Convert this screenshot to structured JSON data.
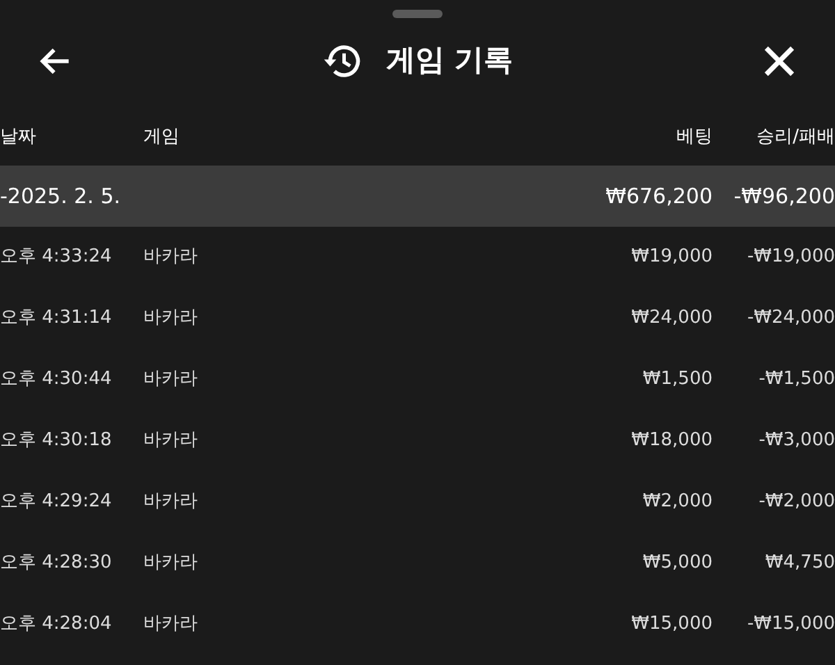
{
  "header": {
    "title": "게임 기록"
  },
  "columns": {
    "date": "날짜",
    "game": "게임",
    "bet": "베팅",
    "result": "승리/패배"
  },
  "groups": [
    {
      "date": "-2025. 2. 5.",
      "bet": "₩676,200",
      "result": "-₩96,200",
      "rows": [
        {
          "time": "오후 4:33:24",
          "game": "바카라",
          "bet": "₩19,000",
          "result": "-₩19,000"
        },
        {
          "time": "오후 4:31:14",
          "game": "바카라",
          "bet": "₩24,000",
          "result": "-₩24,000"
        },
        {
          "time": "오후 4:30:44",
          "game": "바카라",
          "bet": "₩1,500",
          "result": "-₩1,500"
        },
        {
          "time": "오후 4:30:18",
          "game": "바카라",
          "bet": "₩18,000",
          "result": "-₩3,000"
        },
        {
          "time": "오후 4:29:24",
          "game": "바카라",
          "bet": "₩2,000",
          "result": "-₩2,000"
        },
        {
          "time": "오후 4:28:30",
          "game": "바카라",
          "bet": "₩5,000",
          "result": "₩4,750"
        },
        {
          "time": "오후 4:28:04",
          "game": "바카라",
          "bet": "₩15,000",
          "result": "-₩15,000"
        }
      ]
    }
  ]
}
